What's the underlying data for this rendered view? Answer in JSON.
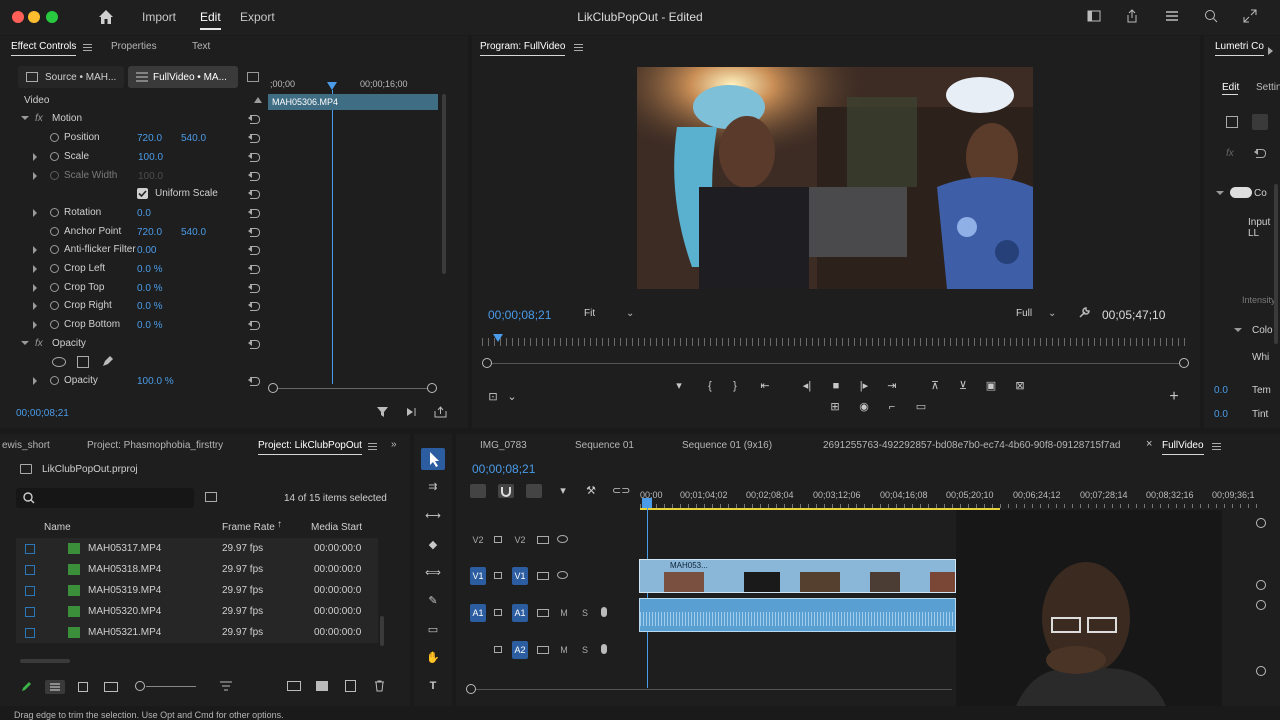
{
  "titlebar": {
    "window_title": "LikClubPopOut - Edited",
    "tabs": [
      "Import",
      "Edit",
      "Export"
    ],
    "active_tab": "Edit"
  },
  "effect_controls": {
    "tabs": [
      "Effect Controls",
      "Properties",
      "Text"
    ],
    "source_tab": "Source • MAH...",
    "sequence_tab": "FullVideo • MA...",
    "timecode_start": ";00;00",
    "timecode_mid": "00;00;16;00",
    "clip_name": "MAH05306.MP4",
    "video_label": "Video",
    "motion_label": "Motion",
    "position_label": "Position",
    "position_x": "720.0",
    "position_y": "540.0",
    "scale_label": "Scale",
    "scale_value": "100.0",
    "scale_width_label": "Scale Width",
    "scale_width_value": "100.0",
    "uniform_scale_label": "Uniform Scale",
    "rotation_label": "Rotation",
    "rotation_value": "0.0",
    "anchor_label": "Anchor Point",
    "anchor_x": "720.0",
    "anchor_y": "540.0",
    "antiflicker_label": "Anti-flicker Filter",
    "antiflicker_value": "0.00",
    "crop_left_label": "Crop Left",
    "crop_left_value": "0.0 %",
    "crop_top_label": "Crop Top",
    "crop_top_value": "0.0 %",
    "crop_right_label": "Crop Right",
    "crop_right_value": "0.0 %",
    "crop_bottom_label": "Crop Bottom",
    "crop_bottom_value": "0.0 %",
    "opacity_section_label": "Opacity",
    "opacity_label": "Opacity",
    "opacity_value": "100.0 %",
    "current_time": "00;00;08;21"
  },
  "program_monitor": {
    "title": "Program: FullVideo",
    "current_time": "00;00;08;21",
    "fit_option": "Fit",
    "quality_option": "Full",
    "duration": "00;05;47;10"
  },
  "lumetri": {
    "title": "Lumetri Co",
    "tabs": [
      "Edit",
      "Settin"
    ],
    "input_label": "Input LL",
    "intensity_label": "Intensity",
    "color_label": "Colo",
    "white_label": "Whi",
    "temp_value": "0.0",
    "temp_label": "Tem",
    "tint_value": "0.0",
    "tint_label": "Tint"
  },
  "project": {
    "tabs": [
      "ewis_short",
      "Project: Phasmophobia_firsttry",
      "Project: LikClubPopOut"
    ],
    "file_name": "LikClubPopOut.prproj",
    "search_placeholder": "",
    "selection_status": "14 of 15 items selected",
    "columns": [
      "Name",
      "Frame Rate",
      "Media Start"
    ],
    "items": [
      {
        "name": "MAH05317.MP4",
        "frame_rate": "29.97 fps",
        "media_start": "00:00:00:0"
      },
      {
        "name": "MAH05318.MP4",
        "frame_rate": "29.97 fps",
        "media_start": "00:00:00:0"
      },
      {
        "name": "MAH05319.MP4",
        "frame_rate": "29.97 fps",
        "media_start": "00:00:00:0"
      },
      {
        "name": "MAH05320.MP4",
        "frame_rate": "29.97 fps",
        "media_start": "00:00:00:0"
      },
      {
        "name": "MAH05321.MP4",
        "frame_rate": "29.97 fps",
        "media_start": "00:00:00:0"
      }
    ]
  },
  "timeline": {
    "tabs": [
      "IMG_0783",
      "Sequence 01",
      "Sequence 01 (9x16)",
      "2691255763-492292857-bd08e7b0-ec74-4b60-90f8-09128715f7ad",
      "FullVideo"
    ],
    "current_time": "00;00;08;21",
    "ruler": [
      "00;00",
      "00;01;04;02",
      "00;02;08;04",
      "00;03;12;06",
      "00;04;16;08",
      "00;05;20;10",
      "00;06;24;12",
      "00;07;28;14",
      "00;08;32;16",
      "00;09;36;1"
    ],
    "tracks": {
      "v2": "V2",
      "v1": "V1",
      "a1": "A1",
      "a2": "A2",
      "src_v1": "V1",
      "src_a1": "A1",
      "mute": "M",
      "solo": "S"
    },
    "clip_label": "MAH053..."
  },
  "status_bar": {
    "text": "Drag edge to trim the selection. Use Opt and Cmd for other options."
  }
}
